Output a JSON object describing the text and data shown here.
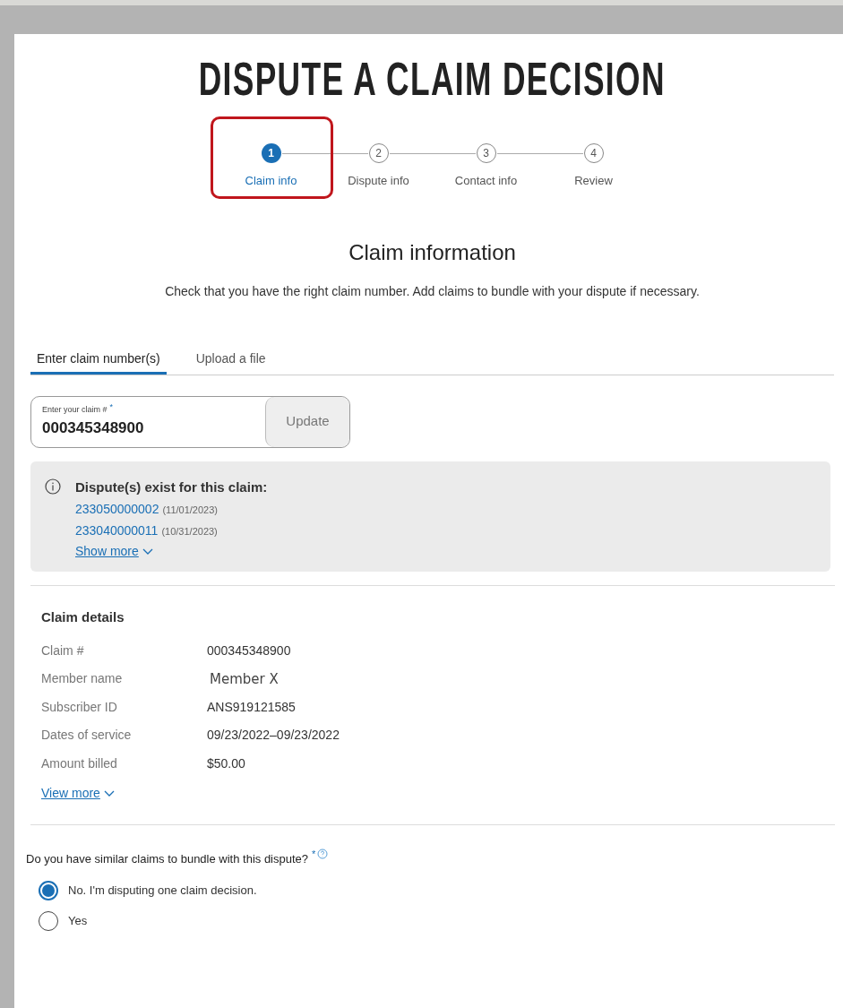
{
  "page_title": "DISPUTE A CLAIM DECISION",
  "steps": [
    {
      "number": "1",
      "label": "Claim info",
      "selected": true
    },
    {
      "number": "2",
      "label": "Dispute info",
      "selected": false
    },
    {
      "number": "3",
      "label": "Contact info",
      "selected": false
    },
    {
      "number": "4",
      "label": "Review",
      "selected": false
    }
  ],
  "section": {
    "title": "Claim information",
    "description": "Check that you have the right claim number. Add claims to bundle with your dispute if necessary."
  },
  "tabs": [
    {
      "label": "Enter claim number(s)",
      "selected": true
    },
    {
      "label": "Upload a file",
      "selected": false
    }
  ],
  "claim_field": {
    "label": "Enter your claim #",
    "required_mark": "*",
    "value": "000345348900"
  },
  "update_button": "Update",
  "notice": {
    "title": "Dispute(s) exist for this claim:",
    "disputes": [
      {
        "number": "233050000002",
        "date": "(11/01/2023)"
      },
      {
        "number": "233040000011",
        "date": "(10/31/2023)"
      }
    ],
    "show_more": "Show more"
  },
  "claim_details": {
    "title": "Claim details",
    "rows": [
      {
        "label": "Claim #",
        "value": "000345348900",
        "kind": "plain"
      },
      {
        "label": "Member name",
        "value": "Member X",
        "kind": "overlay"
      },
      {
        "label": "Subscriber ID",
        "value": "ANS919121585",
        "kind": "plain"
      },
      {
        "label": "Dates of service",
        "value": "09/23/2022–09/23/2022",
        "kind": "plain"
      },
      {
        "label": "Amount billed",
        "value": "$50.00",
        "kind": "plain"
      }
    ],
    "view_more": "View more"
  },
  "bundle_question": {
    "text": "Do you have similar claims to bundle with this dispute?",
    "required_mark": "*",
    "options": [
      {
        "label": "No. I'm disputing one claim decision.",
        "selected": true
      },
      {
        "label": "Yes",
        "selected": false
      }
    ]
  }
}
